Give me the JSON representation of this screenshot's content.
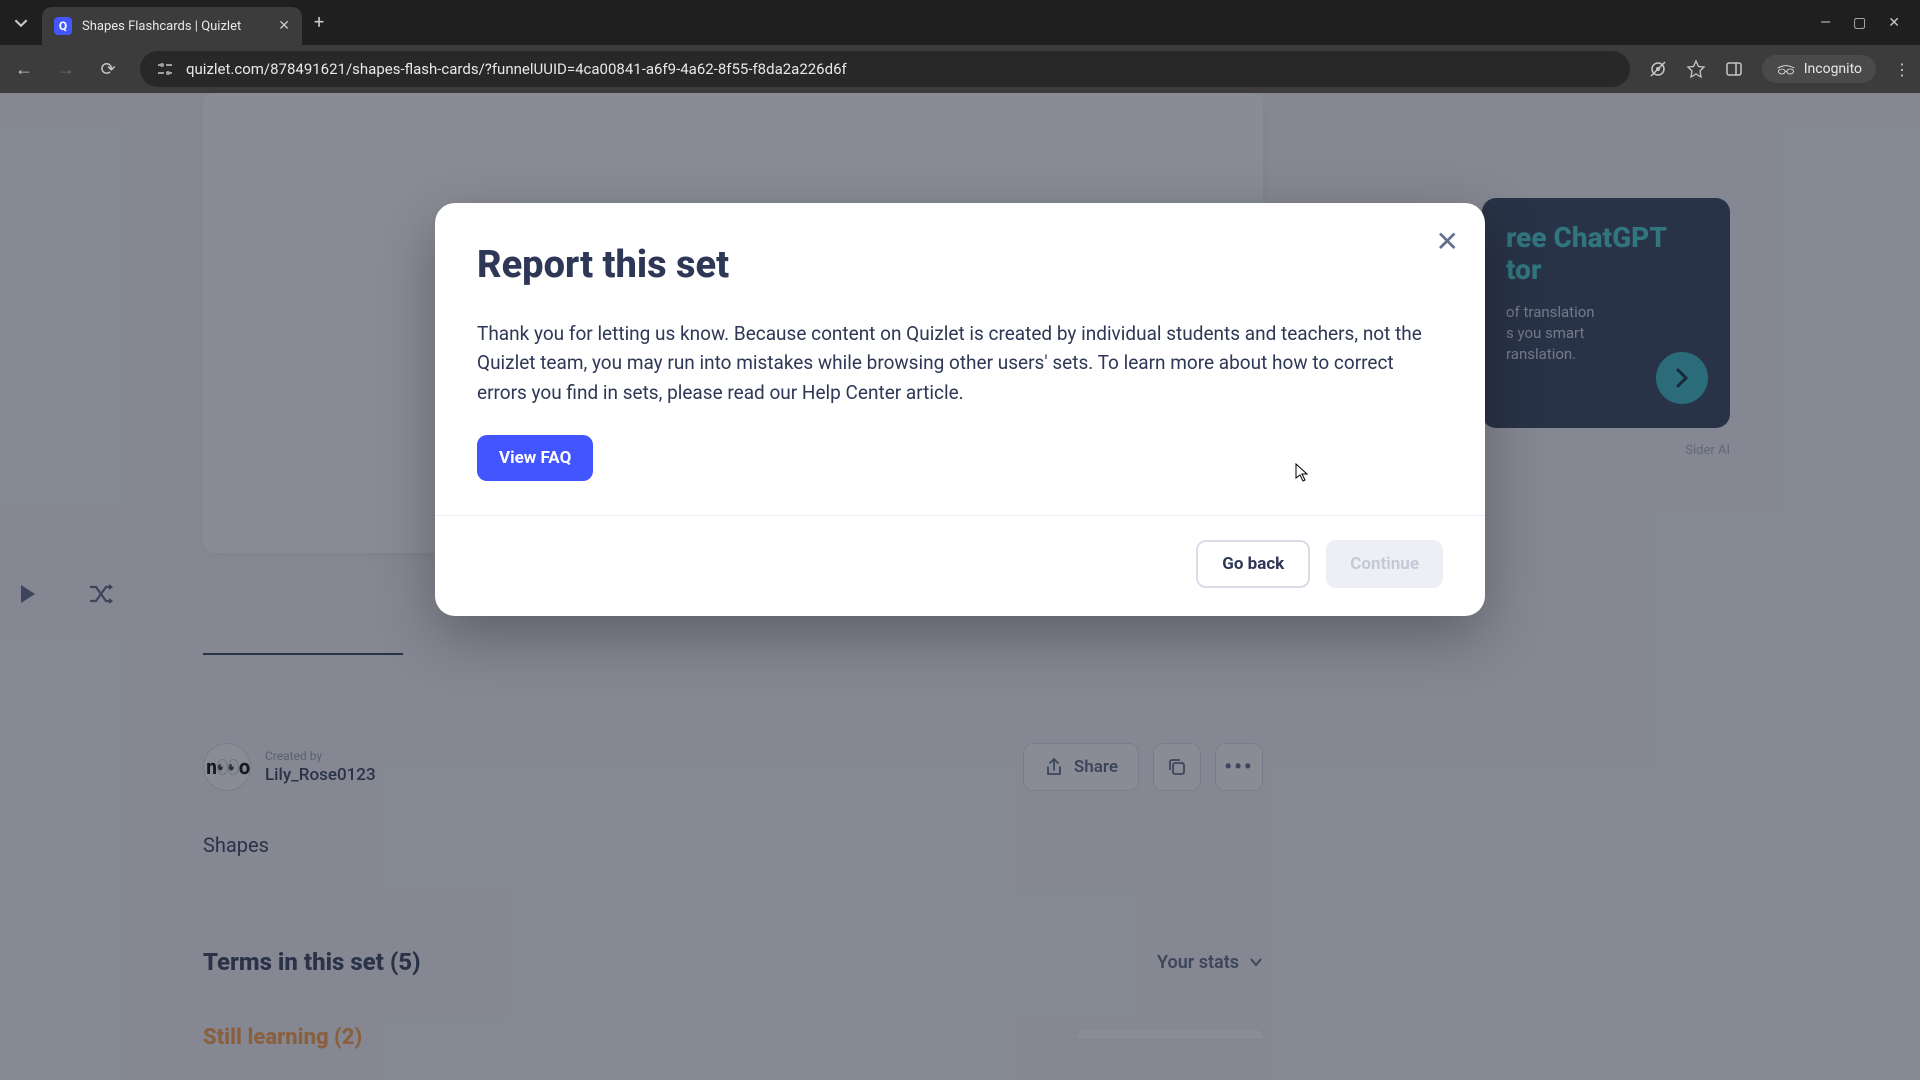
{
  "browser": {
    "tab_title": "Shapes Flashcards | Quizlet",
    "url": "quizlet.com/878491621/shapes-flash-cards/?funnelUUID=4ca00841-a6f9-4a62-8f55-f8da2a226d6f",
    "incognito_label": "Incognito"
  },
  "promo": {
    "title_line1": "ree ChatGPT",
    "title_line2": "tor",
    "body_line1": "of translation",
    "body_line2": "s you smart",
    "body_line3": "ranslation.",
    "credit": "Sider AI"
  },
  "author": {
    "created_by_label": "Created by",
    "name": "Lily_Rose0123",
    "share_label": "Share"
  },
  "set": {
    "title": "Shapes",
    "terms_heading": "Terms in this set (5)",
    "stats_label": "Your stats",
    "still_learning": "Still learning (2)"
  },
  "modal": {
    "title": "Report this set",
    "body": "Thank you for letting us know. Because content on Quizlet is created by individual students and teachers, not the Quizlet team, you may run into mistakes while browsing other users' sets. To learn more about how to correct errors you find in sets, please read our Help Center article.",
    "faq_label": "View FAQ",
    "go_back_label": "Go back",
    "continue_label": "Continue"
  }
}
